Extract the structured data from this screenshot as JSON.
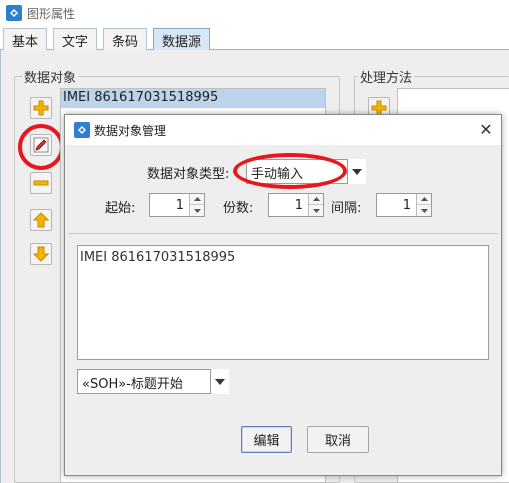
{
  "window": {
    "title": "图形属性",
    "tabs": [
      {
        "label": "基本",
        "active": false
      },
      {
        "label": "文字",
        "active": false
      },
      {
        "label": "条码",
        "active": false
      },
      {
        "label": "数据源",
        "active": true
      }
    ]
  },
  "data_objects": {
    "group_label": "数据对象",
    "items": [
      "IMEI 861617031518995"
    ],
    "buttons": [
      "add-icon",
      "edit-icon",
      "remove-icon",
      "move-up-icon",
      "move-down-icon"
    ]
  },
  "processing": {
    "group_label": "处理方法",
    "buttons": [
      "add-icon"
    ]
  },
  "dialog": {
    "title": "数据对象管理",
    "close_glyph": "✕",
    "type_label": "数据对象类型:",
    "type_value": "手动输入",
    "start_label": "起始:",
    "start_value": "1",
    "copies_label": "份数:",
    "copies_value": "1",
    "interval_label": "间隔:",
    "interval_value": "1",
    "content": "IMEI 861617031518995",
    "control_char": "«SOH»-标题开始",
    "edit_label": "编辑",
    "cancel_label": "取消"
  },
  "colors": {
    "selection": "#bcd3ec",
    "highlight_ring": "#e8161d",
    "tab_active": "#d7e7f7"
  }
}
